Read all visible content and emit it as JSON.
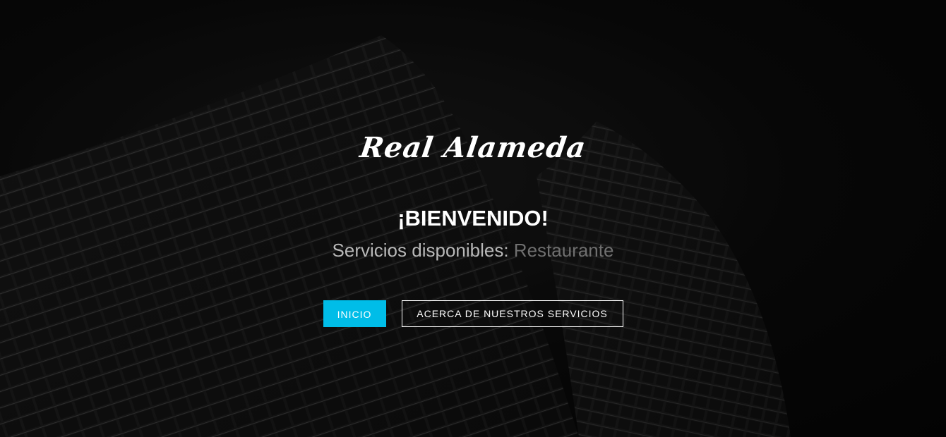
{
  "hero": {
    "logo_text": "Real Alameda",
    "welcome": "¡BIENVENIDO!",
    "services_label": "Servicios disponibles:",
    "services_value": "Restaurante",
    "primary_button": "INICIO",
    "secondary_button": "ACERCA DE NUESTROS SERVICIOS"
  },
  "colors": {
    "accent": "#00bde8",
    "background": "#080808",
    "text": "#ffffff",
    "muted": "#b8b8b8",
    "dim": "#6f6f6f"
  }
}
